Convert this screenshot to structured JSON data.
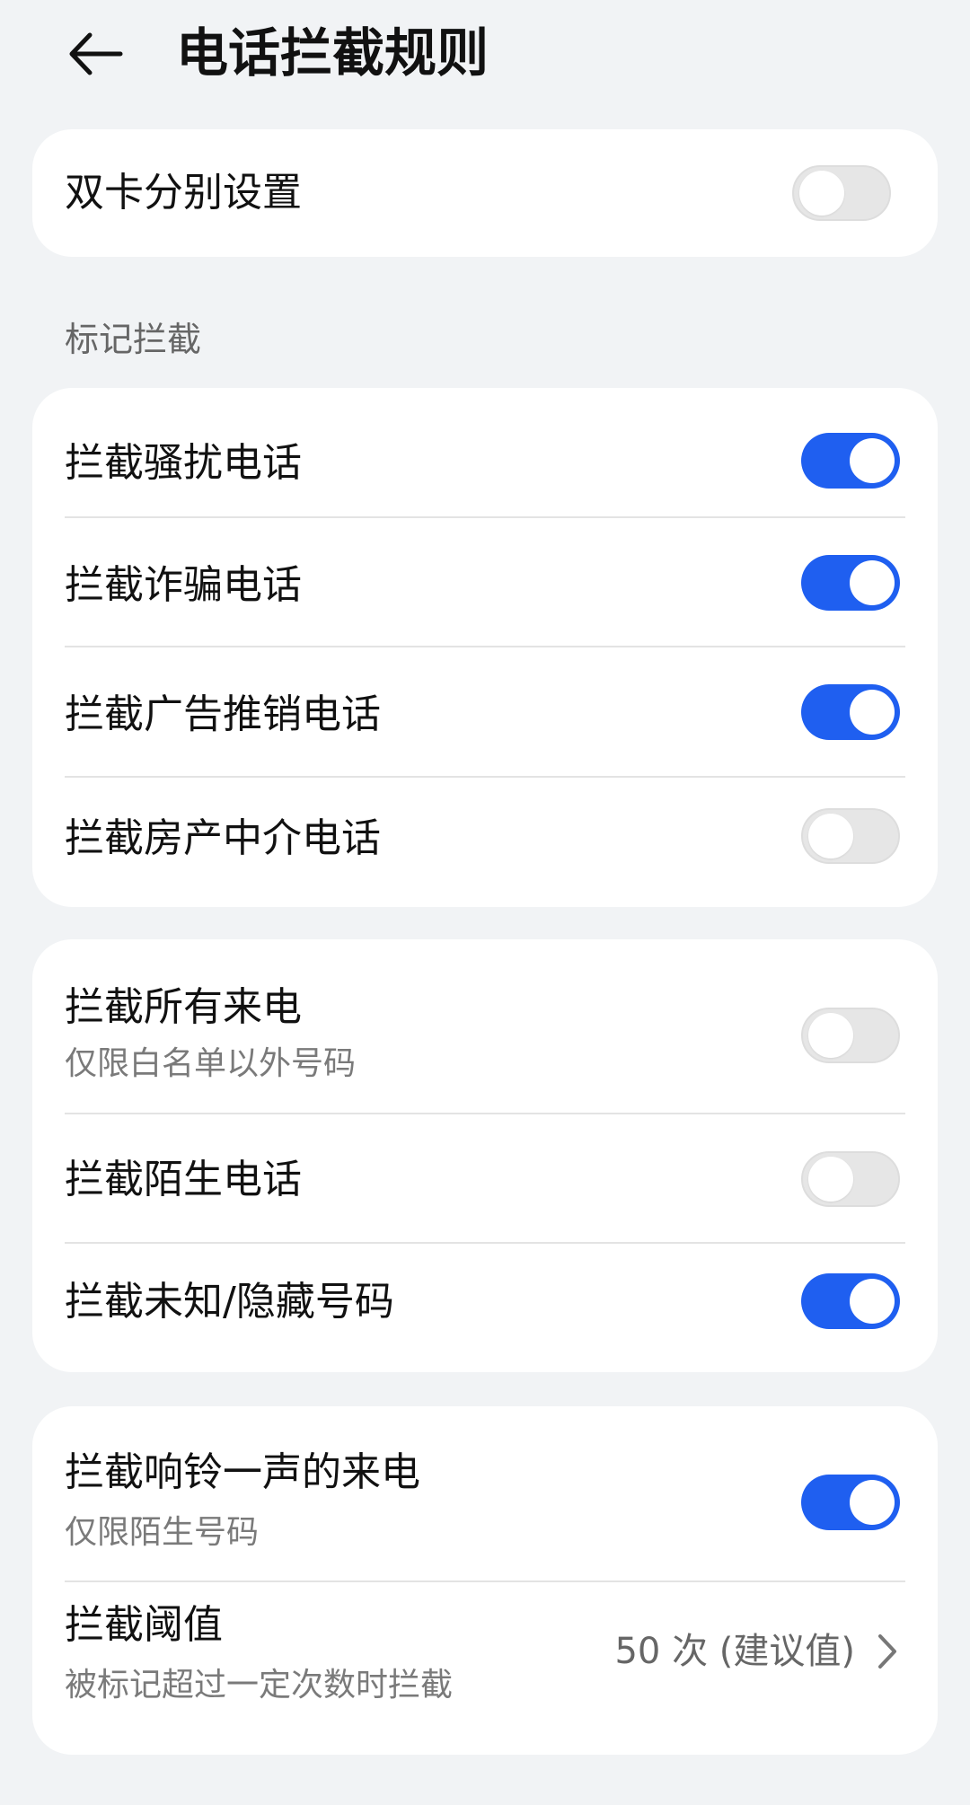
{
  "header": {
    "title": "电话拦截规则"
  },
  "card_dual": {
    "label": "双卡分别设置",
    "enabled": false
  },
  "section_mark": {
    "label": "标记拦截"
  },
  "mark_items": [
    {
      "label": "拦截骚扰电话",
      "enabled": true
    },
    {
      "label": "拦截诈骗电话",
      "enabled": true
    },
    {
      "label": "拦截广告推销电话",
      "enabled": true
    },
    {
      "label": "拦截房产中介电话",
      "enabled": false
    }
  ],
  "general_items": [
    {
      "label": "拦截所有来电",
      "sublabel": "仅限白名单以外号码",
      "enabled": false
    },
    {
      "label": "拦截陌生电话",
      "enabled": false
    },
    {
      "label": "拦截未知/隐藏号码",
      "enabled": true
    }
  ],
  "ring_items": [
    {
      "label": "拦截响铃一声的来电",
      "sublabel": "仅限陌生号码",
      "enabled": true
    }
  ],
  "threshold": {
    "label": "拦截阈值",
    "sublabel": "被标记超过一定次数时拦截",
    "value": "50 次 (建议值)"
  },
  "colors": {
    "toggle_on": "#1f5ff0",
    "toggle_off": "#e6e6e6",
    "background": "#f1f3f5"
  }
}
